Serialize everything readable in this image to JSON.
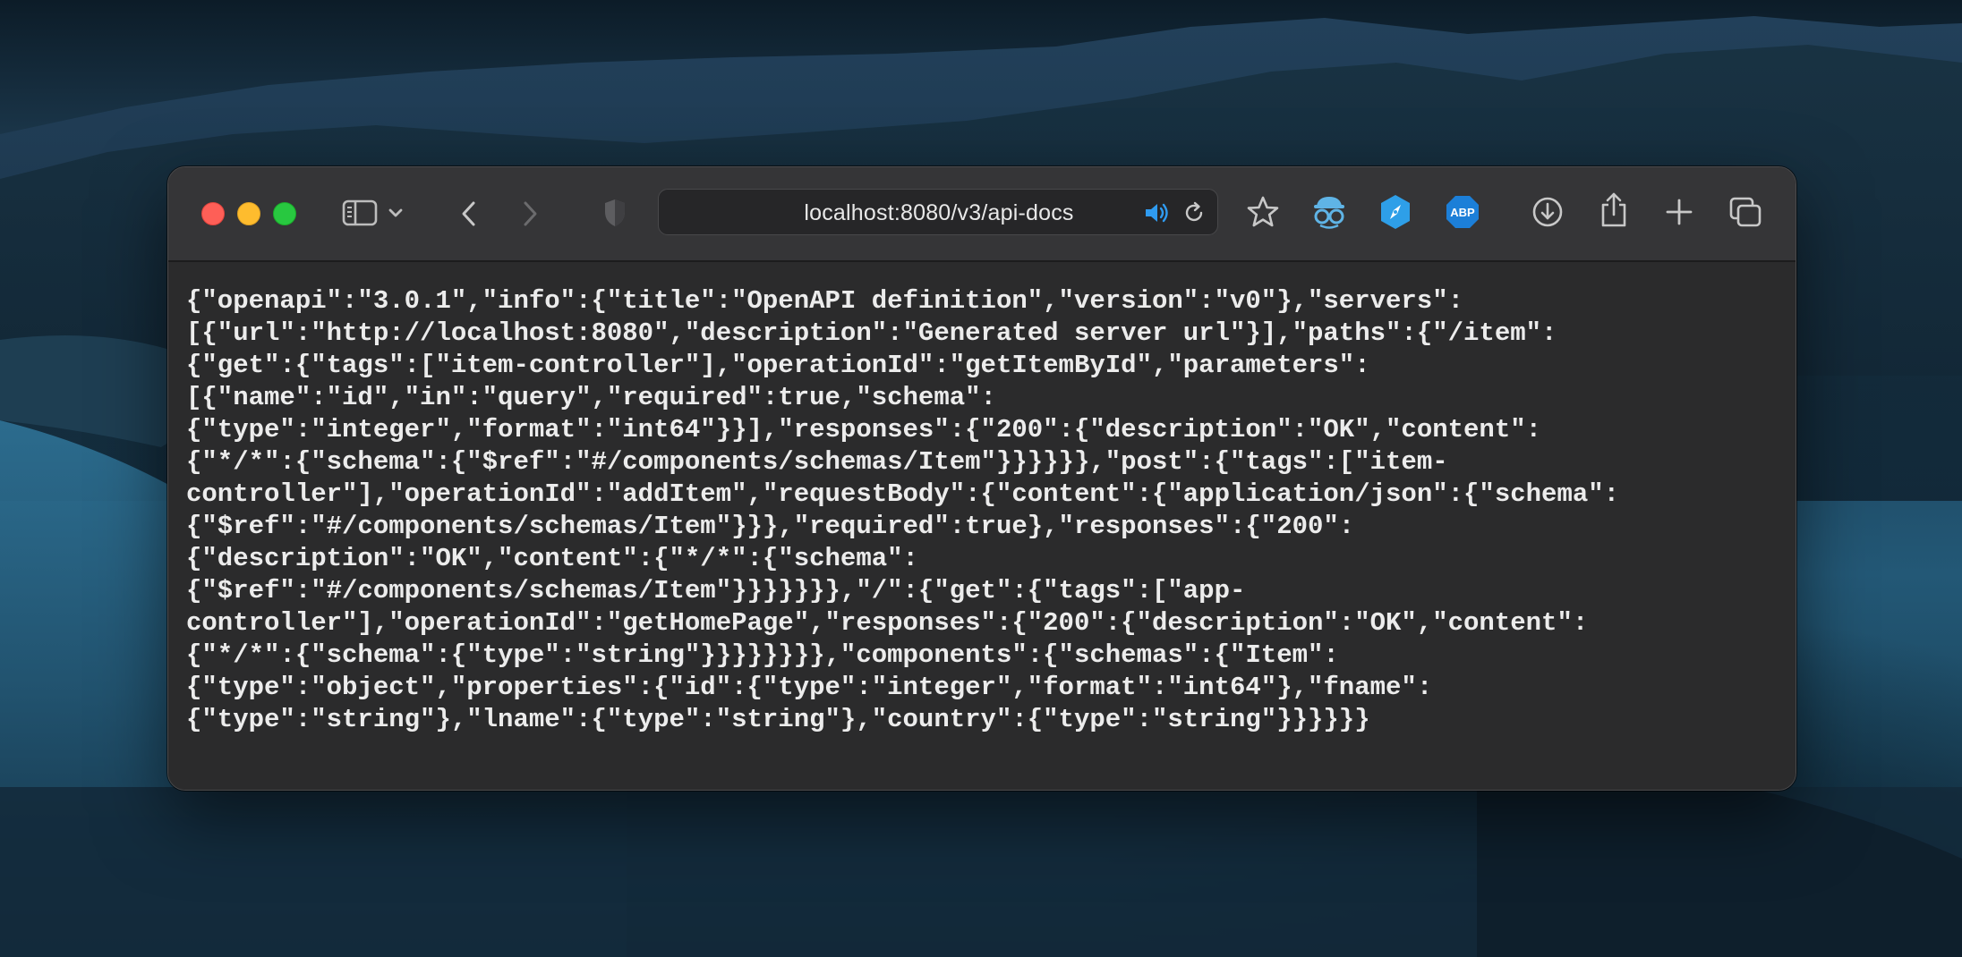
{
  "browser": {
    "url": "localhost:8080/v3/api-docs",
    "toolbar_icons": [
      "close-window",
      "minimize-window",
      "zoom-window",
      "sidebar-icon",
      "chevron-down-icon",
      "back-icon",
      "forward-icon",
      "privacy-shield-icon",
      "speaker-icon",
      "reload-icon",
      "bookmark-star-icon",
      "spy-glasses-extension-icon",
      "compass-extension-icon",
      "adblock-plus-extension-icon",
      "downloads-icon",
      "share-icon",
      "new-tab-icon",
      "tab-overview-icon"
    ],
    "abp_label": "ABP"
  },
  "page": {
    "json_lines": [
      "{\"openapi\":\"3.0.1\",\"info\":{\"title\":\"OpenAPI definition\",\"version\":\"v0\"},\"servers\":",
      "[{\"url\":\"http://localhost:8080\",\"description\":\"Generated server url\"}],\"paths\":{\"/item\":",
      "{\"get\":{\"tags\":[\"item-controller\"],\"operationId\":\"getItemById\",\"parameters\":",
      "[{\"name\":\"id\",\"in\":\"query\",\"required\":true,\"schema\":",
      "{\"type\":\"integer\",\"format\":\"int64\"}}],\"responses\":{\"200\":{\"description\":\"OK\",\"content\":",
      "{\"*/*\":{\"schema\":{\"$ref\":\"#/components/schemas/Item\"}}}}}},\"post\":{\"tags\":[\"item-",
      "controller\"],\"operationId\":\"addItem\",\"requestBody\":{\"content\":{\"application/json\":{\"schema\":",
      "{\"$ref\":\"#/components/schemas/Item\"}}},\"required\":true},\"responses\":{\"200\":",
      "{\"description\":\"OK\",\"content\":{\"*/*\":{\"schema\":",
      "{\"$ref\":\"#/components/schemas/Item\"}}}}}}},\"/\":{\"get\":{\"tags\":[\"app-",
      "controller\"],\"operationId\":\"getHomePage\",\"responses\":{\"200\":{\"description\":\"OK\",\"content\":",
      "{\"*/*\":{\"schema\":{\"type\":\"string\"}}}}}}}},\"components\":{\"schemas\":{\"Item\":",
      "{\"type\":\"object\",\"properties\":{\"id\":{\"type\":\"integer\",\"format\":\"int64\"},\"fname\":",
      "{\"type\":\"string\"},\"lname\":{\"type\":\"string\"},\"country\":{\"type\":\"string\"}}}}}}"
    ]
  },
  "colors": {
    "accent_blue": "#2f9bf0",
    "traffic_red": "#fe5f57",
    "traffic_yellow": "#febc2e",
    "traffic_green": "#28c840"
  }
}
